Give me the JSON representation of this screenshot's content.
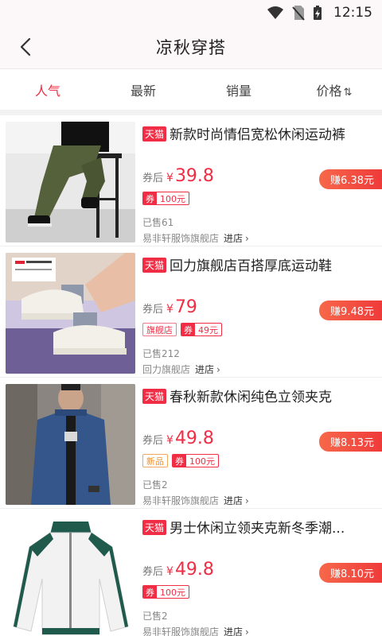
{
  "status_bar": {
    "time": "12:15",
    "icons": [
      "wifi-icon",
      "no-sim-icon",
      "battery-charging-icon"
    ]
  },
  "header": {
    "title": "凉秋穿搭",
    "back_icon": "back-arrow-icon"
  },
  "tabs": [
    {
      "label": "人气",
      "active": true
    },
    {
      "label": "最新",
      "active": false
    },
    {
      "label": "销量",
      "active": false
    },
    {
      "label": "价格",
      "sort_icon": "⇅",
      "active": false
    }
  ],
  "colors": {
    "accent": "#f02d44",
    "earn_badge": "#ef3a3a",
    "new_tag": "#f08f2d"
  },
  "products": [
    {
      "platform": "天猫",
      "name": "新款时尚情侣宽松休闲运动裤",
      "price_label": "券后",
      "currency": "¥",
      "price": "39.8",
      "earn": "赚6.38元",
      "badge": "",
      "coupon_key": "券",
      "coupon_value": "100元",
      "sold": "已售61",
      "shop": "易非轩服饰旗舰店",
      "go_shop": "进店",
      "image": "olive-cargo-pants-photo"
    },
    {
      "platform": "天猫",
      "name": "回力旗舰店百搭厚底运动鞋",
      "price_label": "券后",
      "currency": "¥",
      "price": "79",
      "earn": "赚9.48元",
      "badge": "旗舰店",
      "coupon_key": "券",
      "coupon_value": "49元",
      "sold": "已售212",
      "shop": "回力旗舰店",
      "go_shop": "进店",
      "image": "white-chunky-sneakers-photo"
    },
    {
      "platform": "天猫",
      "name": "春秋新款休闲纯色立领夹克",
      "price_label": "券后",
      "currency": "¥",
      "price": "49.8",
      "earn": "赚8.13元",
      "badge": "新品",
      "coupon_key": "券",
      "coupon_value": "100元",
      "sold": "已售2",
      "shop": "易非轩服饰旗舰店",
      "go_shop": "进店",
      "image": "blue-jacket-photo"
    },
    {
      "platform": "天猫",
      "name": "男士休闲立领夹克新冬季潮...",
      "price_label": "券后",
      "currency": "¥",
      "price": "49.8",
      "earn": "赚8.10元",
      "badge": "",
      "coupon_key": "券",
      "coupon_value": "100元",
      "sold": "已售2",
      "shop": "易非轩服饰旗舰店",
      "go_shop": "进店",
      "image": "white-green-track-jacket-photo"
    }
  ]
}
